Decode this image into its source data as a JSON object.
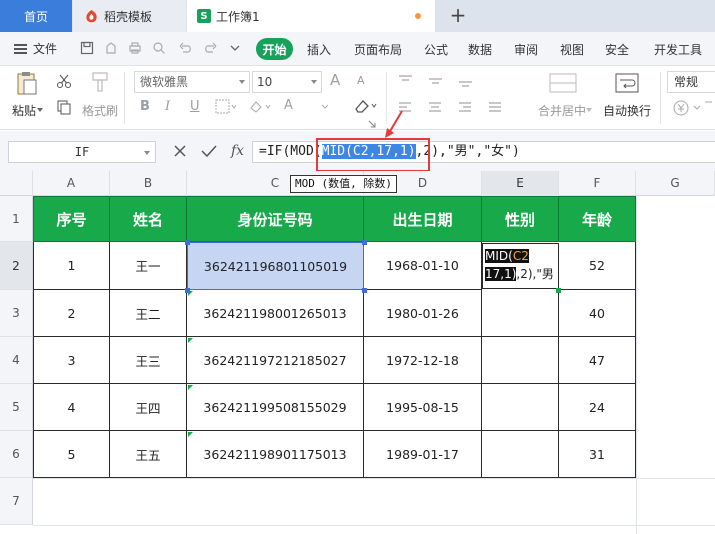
{
  "tabs": {
    "home": "首页",
    "daoke": "稻壳模板",
    "workbook": "工作簿1",
    "workbook_icon": "S",
    "new_tab": "+"
  },
  "menu": {
    "file": "文件",
    "start": "开始",
    "items": [
      "插入",
      "页面布局",
      "公式",
      "数据",
      "审阅",
      "视图",
      "安全",
      "开发工具"
    ]
  },
  "ribbon": {
    "paste": "粘贴",
    "format_painter": "格式刷",
    "font_name": "微软雅黑",
    "font_size": "10",
    "merge_center": "合并居中",
    "wrap_text": "自动换行",
    "number_format": "常规",
    "bold": "B",
    "italic": "I",
    "underline": "U",
    "font_grow": "A",
    "font_shrink": "A",
    "font_color_letter": "A"
  },
  "formula_bar": {
    "name_box": "IF",
    "fx": "fx",
    "formula_prefix": "=IF(MOD(",
    "formula_highlight": "MID(C2,17,1)",
    "formula_suffix": ",2),\"男\",\"女\")",
    "tooltip": "MOD (数值, 除数)"
  },
  "sheet": {
    "columns": [
      "A",
      "B",
      "C",
      "D",
      "E",
      "F",
      "G"
    ],
    "rows": [
      "1",
      "2",
      "3",
      "4",
      "5",
      "6",
      "7"
    ],
    "headers": [
      "序号",
      "姓名",
      "身份证号码",
      "出生日期",
      "性别",
      "年龄"
    ],
    "data": [
      {
        "no": "1",
        "name": "王一",
        "id": "362421196801105019",
        "birth": "1968-01-10",
        "gender": "",
        "age": "52"
      },
      {
        "no": "2",
        "name": "王二",
        "id": "362421198001265013",
        "birth": "1980-01-26",
        "gender": "",
        "age": "40"
      },
      {
        "no": "3",
        "name": "王三",
        "id": "362421197212185027",
        "birth": "1972-12-18",
        "gender": "",
        "age": "47"
      },
      {
        "no": "4",
        "name": "王四",
        "id": "362421199508155029",
        "birth": "1995-08-15",
        "gender": "",
        "age": "24"
      },
      {
        "no": "5",
        "name": "王五",
        "id": "362421198901175013",
        "birth": "1989-01-17",
        "gender": "",
        "age": "31"
      }
    ],
    "editing_cell": {
      "part1": "MID(",
      "part2": "C2",
      "part3": "17,1)",
      "part4": ",2),\"男"
    }
  },
  "colors": {
    "accent": "#17a15a",
    "header_green": "#17a94a",
    "tab_blue": "#3b7ddb",
    "highlight_blue": "#3d86e4",
    "annotation_red": "#e23b3b"
  }
}
